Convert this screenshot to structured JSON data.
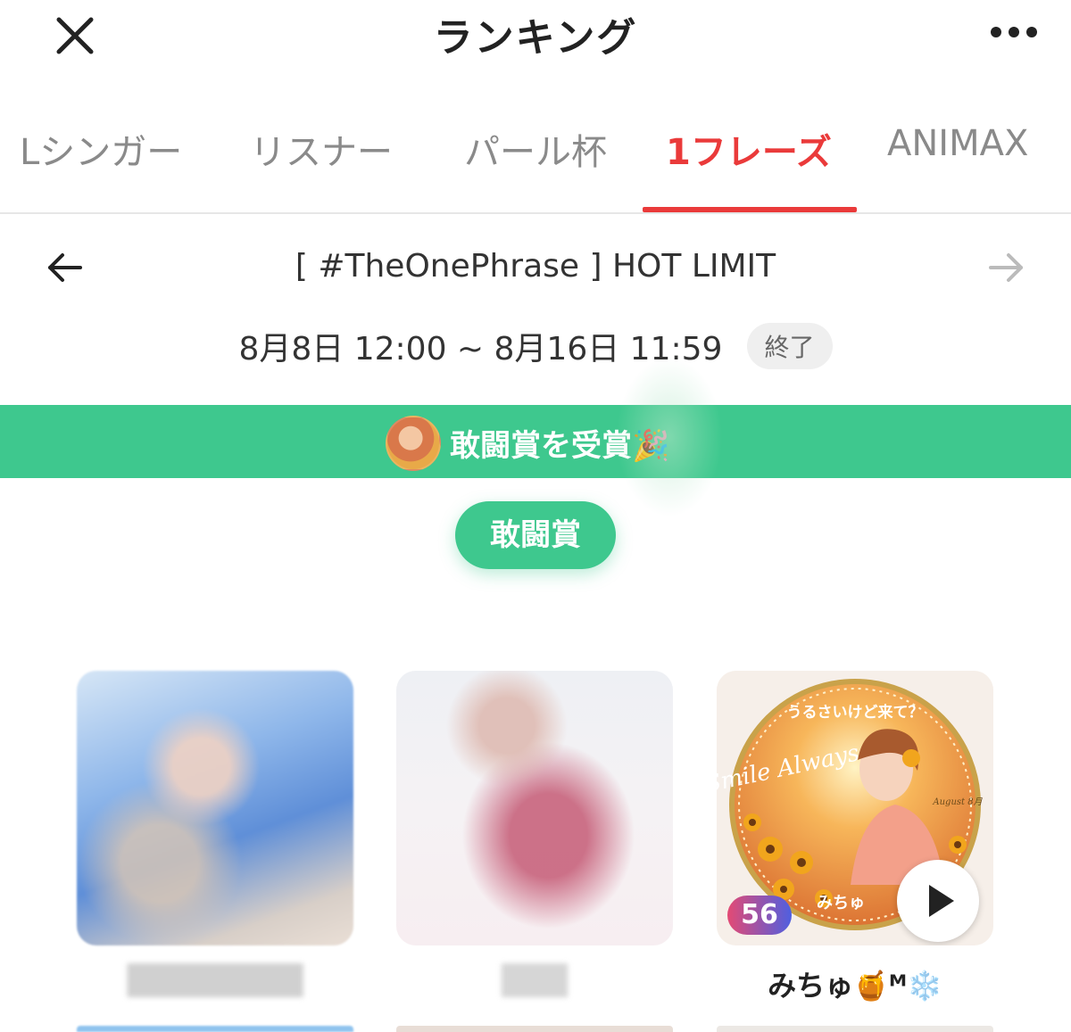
{
  "header": {
    "title": "ランキング",
    "close_icon": "close-icon",
    "more_icon": "more-dots-icon"
  },
  "tabs": [
    {
      "label": "Lシンガー",
      "active": false
    },
    {
      "label": "リスナー",
      "active": false
    },
    {
      "label": "パール杯",
      "active": false
    },
    {
      "label": "1フレーズ",
      "active": true
    },
    {
      "label": "ANIMAX",
      "active": false
    }
  ],
  "event": {
    "title": "[ #TheOnePhrase ] HOT LIMIT",
    "period": "8月8日 12:00 ~ 8月16日 11:59",
    "status": "終了"
  },
  "banner": {
    "text": "敢闘賞を受賞🎉"
  },
  "award": {
    "label": "敢闘賞"
  },
  "cards": [
    {
      "name": "",
      "blurred": true
    },
    {
      "name": "",
      "blurred": true
    },
    {
      "name": "みちゅ🍯ᴹ❄️",
      "count": "56",
      "blurred": false,
      "art_text_top": "うるさいけど来て？",
      "art_text_script": "Smile Always",
      "art_text_tag": "みちゅ",
      "art_text_month": "August 8月"
    }
  ],
  "colors": {
    "accent_red": "#ea3a3a",
    "award_green": "#3ec88e"
  }
}
